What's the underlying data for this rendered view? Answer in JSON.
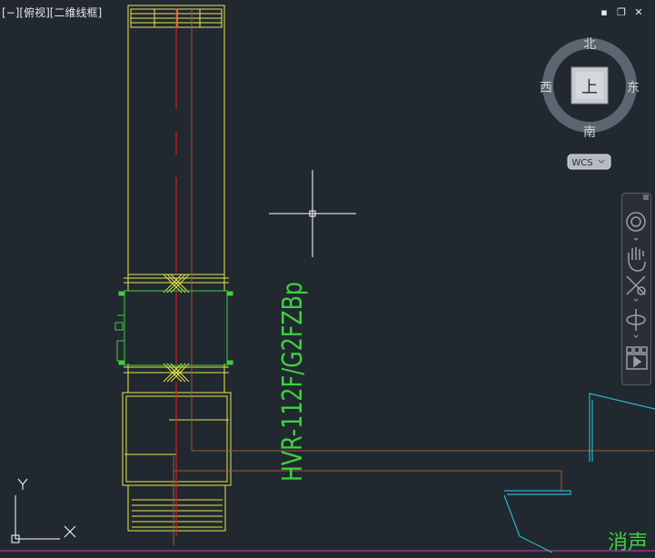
{
  "viewport": {
    "label": "[−][俯视][二维线框]",
    "controls": {
      "minimize": "▪",
      "restore": "❐",
      "close": "✕"
    }
  },
  "viewcube": {
    "face": "上",
    "north": "北",
    "south": "南",
    "east": "东",
    "west": "西",
    "ucs_label": "WCS"
  },
  "drawing": {
    "annotation": "HVR-112F/G2FZBp",
    "partial_text": "消声"
  },
  "ucs_icon": {
    "x_label": "X",
    "y_label": "Y"
  },
  "colors": {
    "background": "#212830",
    "equipment": "#e6e64a",
    "duct": "#3cd23c",
    "centerline": "#d42020",
    "pipe": "#9a5a3a",
    "wall": "#2ab5c4",
    "crosshair": "#ffffff"
  },
  "navbar": {
    "buttons": [
      "steering-wheel-icon",
      "pan-hand-icon",
      "zoom-extents-icon",
      "orbit-icon",
      "showmotion-icon"
    ]
  }
}
